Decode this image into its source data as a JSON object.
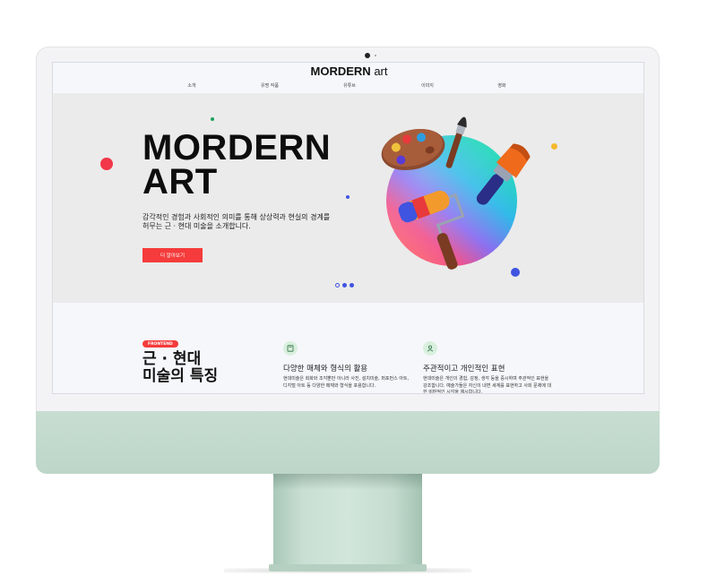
{
  "site": {
    "logo_bold": "MORDERN",
    "logo_light": "art",
    "nav": [
      "소개",
      "유명 작품",
      "유튜브",
      "이미지",
      "영화"
    ]
  },
  "hero": {
    "title_line1": "MORDERN",
    "title_line2": "ART",
    "desc_line1": "감각적인 경험과 사회적인 의미를 통해 상상력과 현실의 경계를",
    "desc_line2": "허무는 근 · 현대 미술을 소개합니다.",
    "button": "더 알아보기"
  },
  "features": {
    "badge": "FRONTEND",
    "title_line1": "근 · 현대",
    "title_line2": "미술의 특징",
    "items": [
      {
        "icon": "book-icon",
        "title": "다양한 매체와 형식의 활용",
        "desc": "현대미술은 회화와 조각뿐만 아니라 사진, 설치미술, 퍼포먼스 아트, 디지털 아트 등 다양한 매체와 형식을 포용합니다."
      },
      {
        "icon": "person-icon",
        "title": "주관적이고 개인적인 표현",
        "desc": "현대미술은 개인의 경험, 감정, 생각 등을 중시하며 주관적인 표현을 강조합니다. 예술가들은 자신의 내면 세계를 표현하고 사회 문제에 대한 비판적인 시각을 제시합니다."
      }
    ]
  },
  "colors": {
    "accent": "#f53b3b",
    "pager": "#3f54e0",
    "imac_body": "#c2d9cc",
    "icon_bg": "#d8f0dd"
  }
}
